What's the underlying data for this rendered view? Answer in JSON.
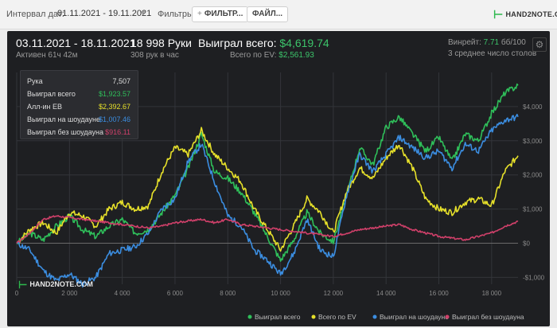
{
  "filters": {
    "interval_label": "Интервал дат:",
    "date_range": "01.11.2021 - 19.11.2021",
    "filters_label": "Фильтры:",
    "filter_button": "ФИЛЬТР...",
    "file_button": "ФАЙЛ...",
    "logo": "HAND2NOTE.COM"
  },
  "header": {
    "date_range": "03.11.2021 - 18.11.2021",
    "active": "Активен 61ч 42м",
    "hands": "18 998 Руки",
    "hands_rate": "308 рук в час",
    "won_label": "Выиграл всего:",
    "won_value": "$4,619.74",
    "ev_label": "Всего по EV:",
    "ev_value": "$2,561.93",
    "winrate_label": "Винрейт:",
    "winrate_value": "7.71",
    "winrate_suffix": "бб/100",
    "avg_tables": "3 среднее число столов"
  },
  "tooltip": {
    "hand_label": "Рука",
    "hand_value": "7,507",
    "won_label": "Выиграл всего",
    "won_value": "$1,923.57",
    "ev_label": "Алл-ин EB",
    "ev_value": "$2,392.67",
    "sd_label": "Выиграл на шоудауне",
    "sd_value": "$1,007.46",
    "nsd_label": "Выиграл без шоудауна",
    "nsd_value": "$916.11"
  },
  "watermark": "HAND2NOTE.COM",
  "colors": {
    "won": "#2fbf5a",
    "ev": "#e6e02a",
    "sd": "#3b8de0",
    "nsd": "#d0406a",
    "grid": "#33353a"
  },
  "chart_data": {
    "type": "line",
    "xlim": [
      0,
      19000
    ],
    "ylim": [
      -1200,
      5000
    ],
    "x_ticks": [
      0,
      2000,
      4000,
      6000,
      8000,
      10000,
      12000,
      14000,
      16000,
      18000
    ],
    "x_tick_labels": [
      "0",
      "2 000",
      "4 000",
      "6 000",
      "8 000",
      "10 000",
      "12 000",
      "14 000",
      "16 000",
      "18 000"
    ],
    "y_ticks": [
      -1000,
      0,
      1000,
      2000,
      3000,
      4000
    ],
    "y_tick_labels": [
      "-$1,000",
      "$0",
      "$1,000",
      "$2,000",
      "$3,000",
      "$4,000"
    ],
    "x": [
      0,
      500,
      1000,
      1500,
      2000,
      2500,
      3000,
      3500,
      4000,
      4500,
      5000,
      5500,
      6000,
      6500,
      7000,
      7500,
      8000,
      8500,
      9000,
      9500,
      10000,
      10500,
      11000,
      11500,
      12000,
      12500,
      13000,
      13500,
      14000,
      14500,
      15000,
      15500,
      16000,
      16500,
      17000,
      17500,
      18000,
      18500,
      19000
    ],
    "series": [
      {
        "name": "Выиграл всего",
        "values": [
          0,
          300,
          100,
          500,
          800,
          400,
          200,
          500,
          700,
          300,
          400,
          900,
          1400,
          2200,
          3200,
          2100,
          1900,
          1500,
          900,
          200,
          -500,
          100,
          900,
          300,
          50,
          1400,
          2800,
          2300,
          3400,
          3700,
          3200,
          2700,
          3100,
          2400,
          3200,
          3000,
          3800,
          4400,
          4620
        ]
      },
      {
        "name": "Всего по EV",
        "values": [
          0,
          400,
          600,
          300,
          900,
          800,
          500,
          1000,
          1200,
          1000,
          1100,
          2100,
          2800,
          2600,
          3300,
          2600,
          2200,
          1800,
          1000,
          400,
          -200,
          500,
          1300,
          900,
          300,
          1500,
          2200,
          1900,
          2500,
          2900,
          2200,
          1300,
          1000,
          900,
          1200,
          1300,
          1100,
          2100,
          2562
        ]
      },
      {
        "name": "Выиграл на шоудауне",
        "values": [
          0,
          -200,
          -800,
          -1100,
          -900,
          -1200,
          -1000,
          -300,
          -200,
          -100,
          300,
          1000,
          1300,
          2400,
          2900,
          1800,
          800,
          500,
          -200,
          -500,
          -900,
          -300,
          700,
          -200,
          -400,
          1400,
          2600,
          2100,
          2600,
          3100,
          2800,
          2500,
          2700,
          2200,
          2900,
          2700,
          3300,
          3600,
          3700
        ]
      },
      {
        "name": "Выиграл без шоудауна",
        "values": [
          0,
          300,
          700,
          800,
          750,
          700,
          650,
          600,
          550,
          500,
          450,
          500,
          600,
          650,
          700,
          600,
          700,
          550,
          500,
          450,
          400,
          350,
          300,
          250,
          200,
          300,
          400,
          450,
          500,
          550,
          400,
          300,
          200,
          150,
          100,
          200,
          300,
          500,
          640
        ]
      }
    ]
  }
}
